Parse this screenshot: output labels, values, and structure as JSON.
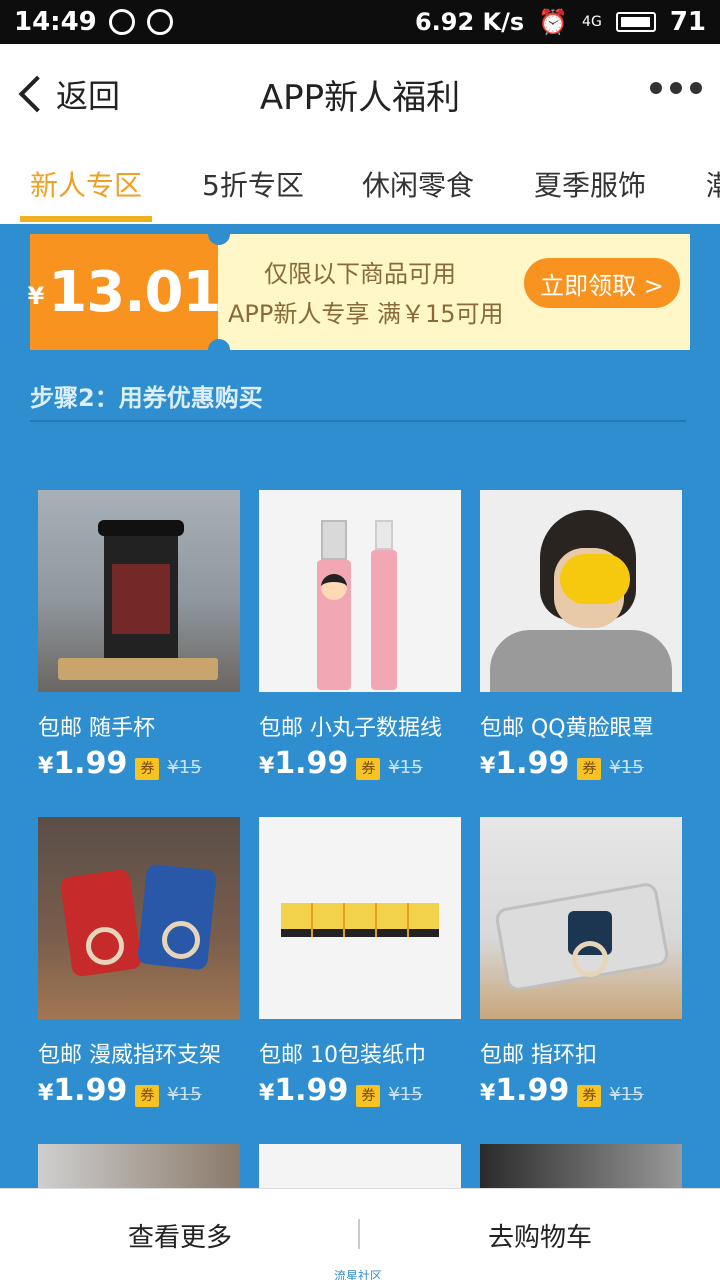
{
  "status_bar": {
    "time": "14:49",
    "speed": "6.92 K/s",
    "battery": "71",
    "network": "4G"
  },
  "nav": {
    "back_label": "返回",
    "title": "APP新人福利"
  },
  "tabs": [
    "新人专区",
    "5折专区",
    "休闲零食",
    "夏季服饰",
    "潮"
  ],
  "coupon": {
    "currency": "¥",
    "amount": "13.01",
    "line1": "仅限以下商品可用",
    "line2": "APP新人专享 满￥15可用",
    "button": "立即领取 >"
  },
  "step_title": "步骤2：用券优惠购买",
  "products": [
    {
      "name": "包邮 随手杯",
      "currency": "¥",
      "price": "1.99",
      "tag": "券",
      "original": "¥15",
      "image": "coffee-cup"
    },
    {
      "name": "包邮 小丸子数据线",
      "currency": "¥",
      "price": "1.99",
      "tag": "券",
      "original": "¥15",
      "image": "usb-cable"
    },
    {
      "name": "包邮 QQ黄脸眼罩",
      "currency": "¥",
      "price": "1.99",
      "tag": "券",
      "original": "¥15",
      "image": "eye-mask"
    },
    {
      "name": "包邮 漫威指环支架",
      "currency": "¥",
      "price": "1.99",
      "tag": "券",
      "original": "¥15",
      "image": "ring-holders"
    },
    {
      "name": "包邮 10包装纸巾",
      "currency": "¥",
      "price": "1.99",
      "tag": "券",
      "original": "¥15",
      "image": "tissue-pack"
    },
    {
      "name": "包邮 指环扣",
      "currency": "¥",
      "price": "1.99",
      "tag": "券",
      "original": "¥15",
      "image": "phone-ring"
    }
  ],
  "bottom": {
    "left": "查看更多",
    "right": "去购物车",
    "watermark": "流星社区"
  },
  "colors": {
    "accent": "#f7931e",
    "background": "#2f8ed0",
    "tab_active": "#f0a020"
  }
}
